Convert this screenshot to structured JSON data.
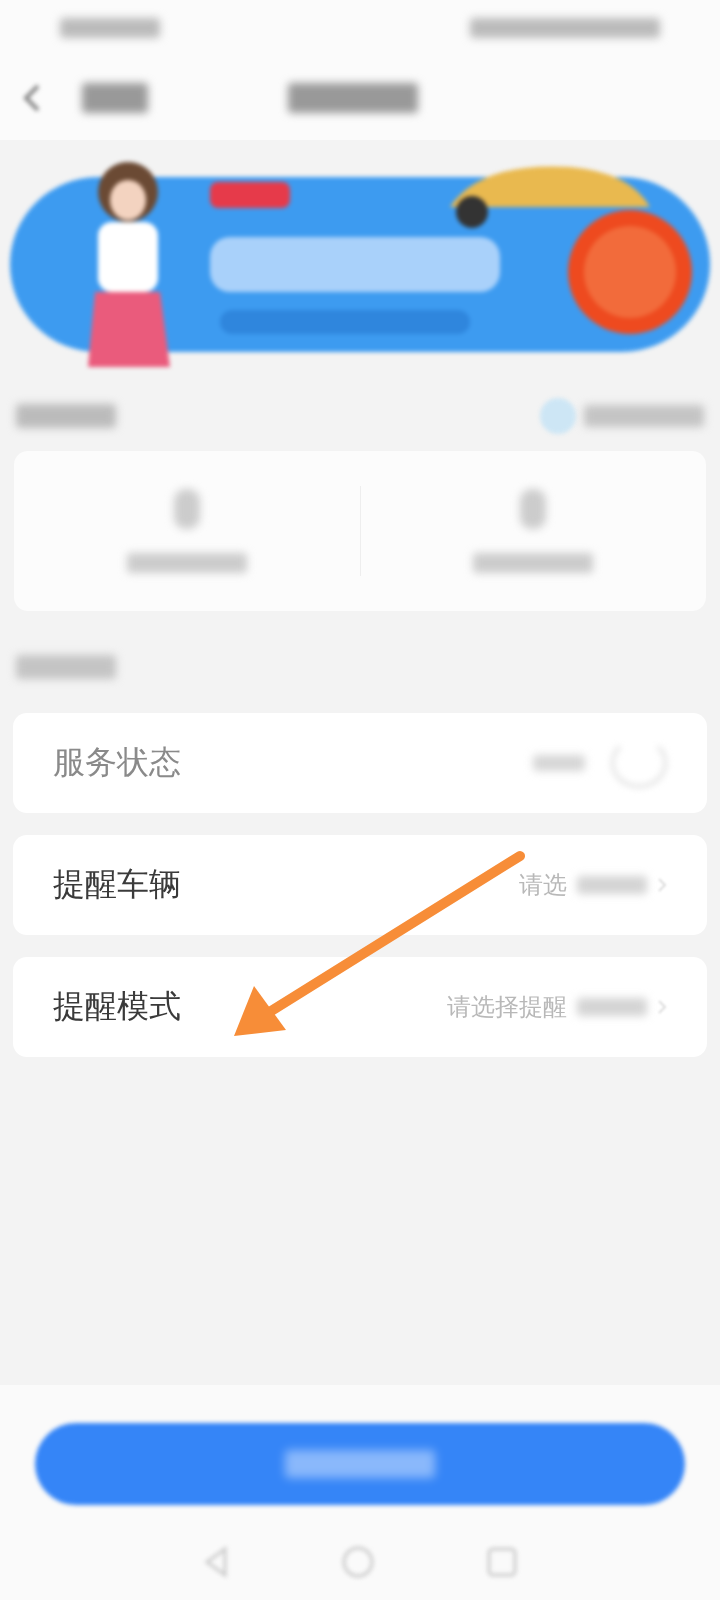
{
  "settings_rows": [
    {
      "label": "服务状态",
      "kind": "toggle",
      "disabled": true,
      "on": false
    },
    {
      "label": "提醒车辆",
      "kind": "select",
      "disabled": false,
      "value": "请选"
    },
    {
      "label": "提醒模式",
      "kind": "select",
      "disabled": false,
      "value": "请选择提醒"
    }
  ]
}
